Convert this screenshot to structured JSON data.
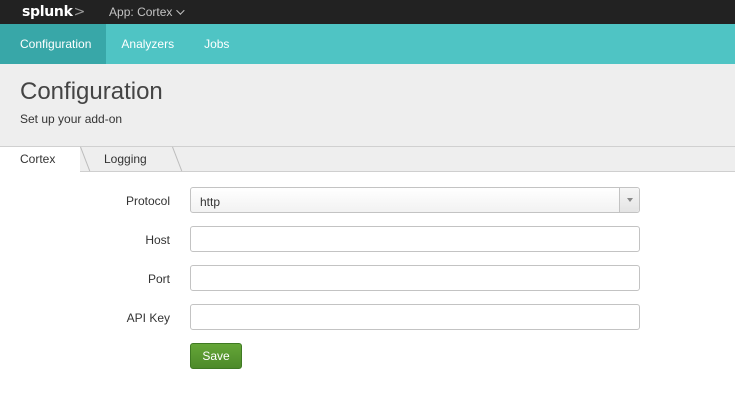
{
  "topbar": {
    "logo_text": "splunk",
    "logo_suffix": ">",
    "app_label": "App: Cortex"
  },
  "nav": {
    "items": [
      {
        "label": "Configuration",
        "active": true
      },
      {
        "label": "Analyzers",
        "active": false
      },
      {
        "label": "Jobs",
        "active": false
      }
    ]
  },
  "header": {
    "title": "Configuration",
    "subtitle": "Set up your add-on"
  },
  "tabs": [
    {
      "label": "Cortex",
      "active": true
    },
    {
      "label": "Logging",
      "active": false
    }
  ],
  "form": {
    "protocol": {
      "label": "Protocol",
      "value": "http"
    },
    "host": {
      "label": "Host",
      "value": ""
    },
    "port": {
      "label": "Port",
      "value": ""
    },
    "api_key": {
      "label": "API Key",
      "value": ""
    },
    "save_label": "Save"
  },
  "colors": {
    "nav_bg": "#4fc4c4",
    "nav_active": "#38a7a8",
    "save_button": "#5a9a32"
  }
}
